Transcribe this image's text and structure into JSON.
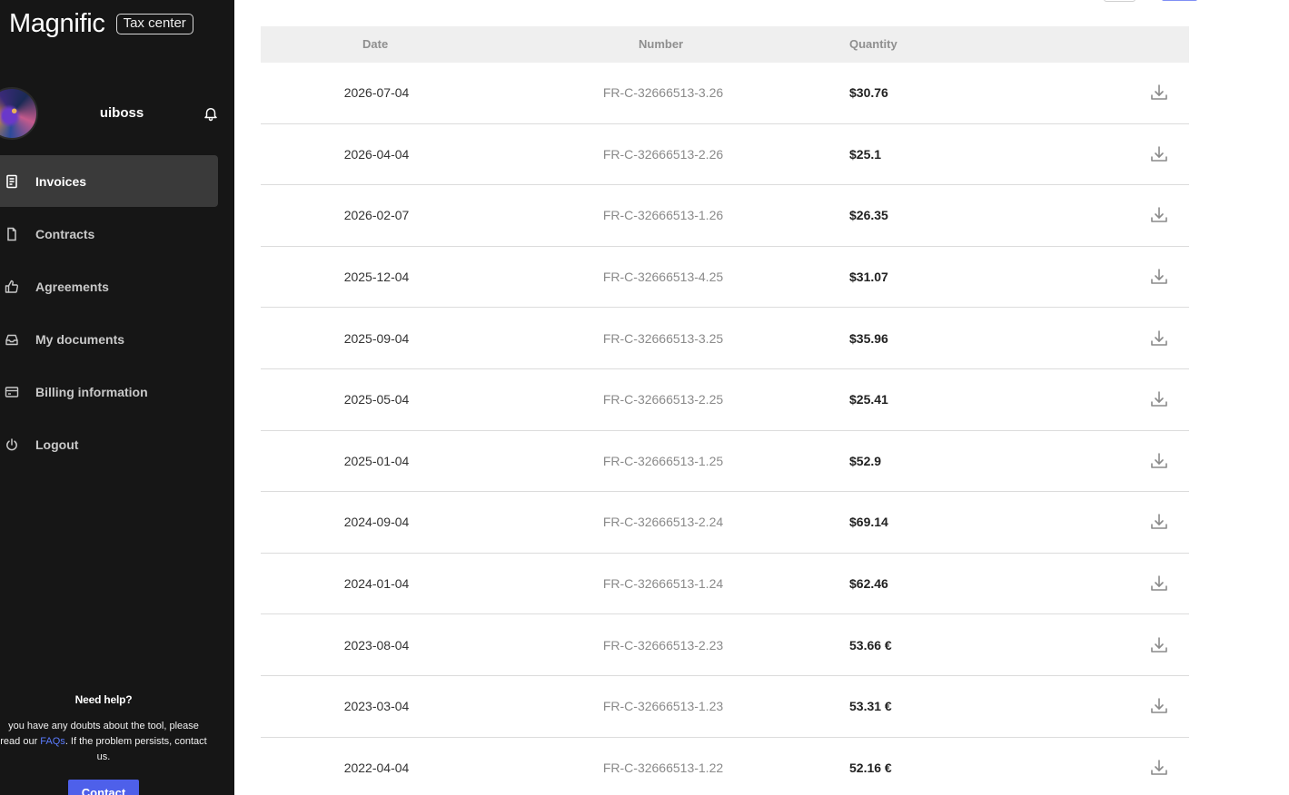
{
  "brand": {
    "name": "Magnific",
    "tag": "Tax center"
  },
  "profile": {
    "username": "uiboss",
    "notification_icon": "bell-icon"
  },
  "nav": [
    {
      "label": "Invoices",
      "icon": "invoice-icon",
      "active": true
    },
    {
      "label": "Contracts",
      "icon": "file-icon",
      "active": false
    },
    {
      "label": "Agreements",
      "icon": "thumbs-up-icon",
      "active": false
    },
    {
      "label": "My documents",
      "icon": "inbox-icon",
      "active": false
    },
    {
      "label": "Billing information",
      "icon": "credit-card-icon",
      "active": false
    },
    {
      "label": "Logout",
      "icon": "power-icon",
      "active": false
    }
  ],
  "help": {
    "title": "Need help?",
    "text_before": "you have any doubts about the tool, please read our ",
    "link": "FAQs",
    "text_after": ". If the problem persists, contact us.",
    "button": "Contact"
  },
  "table": {
    "headers": {
      "date": "Date",
      "number": "Number",
      "quantity": "Quantity"
    },
    "rows": [
      {
        "date": "2026-07-04",
        "number": "FR-C-32666513-3.26",
        "quantity": "$30.76"
      },
      {
        "date": "2026-04-04",
        "number": "FR-C-32666513-2.26",
        "quantity": "$25.1"
      },
      {
        "date": "2026-02-07",
        "number": "FR-C-32666513-1.26",
        "quantity": "$26.35"
      },
      {
        "date": "2025-12-04",
        "number": "FR-C-32666513-4.25",
        "quantity": "$31.07"
      },
      {
        "date": "2025-09-04",
        "number": "FR-C-32666513-3.25",
        "quantity": "$35.96"
      },
      {
        "date": "2025-05-04",
        "number": "FR-C-32666513-2.25",
        "quantity": "$25.41"
      },
      {
        "date": "2025-01-04",
        "number": "FR-C-32666513-1.25",
        "quantity": "$52.9"
      },
      {
        "date": "2024-09-04",
        "number": "FR-C-32666513-2.24",
        "quantity": "$69.14"
      },
      {
        "date": "2024-01-04",
        "number": "FR-C-32666513-1.24",
        "quantity": "$62.46"
      },
      {
        "date": "2023-08-04",
        "number": "FR-C-32666513-2.23",
        "quantity": "53.66 €"
      },
      {
        "date": "2023-03-04",
        "number": "FR-C-32666513-1.23",
        "quantity": "53.31 €"
      },
      {
        "date": "2022-04-04",
        "number": "FR-C-32666513-1.22",
        "quantity": "52.16 €"
      }
    ],
    "row_action_icon": "download-icon"
  },
  "colors": {
    "sidebar_bg": "#161616",
    "active_item": "#3a3a3a",
    "accent": "#4e60ea",
    "link": "#5b7cff"
  }
}
